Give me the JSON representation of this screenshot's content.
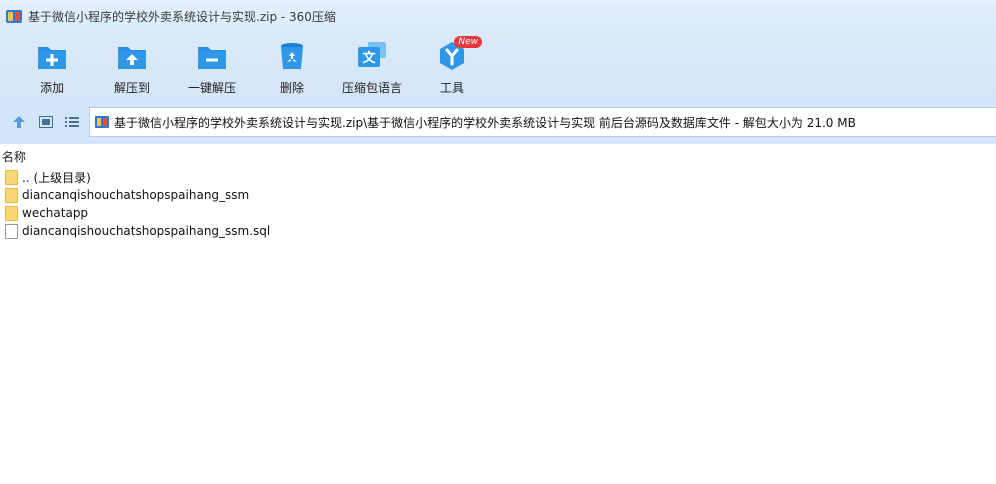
{
  "window": {
    "title": "基于微信小程序的学校外卖系统设计与实现.zip - 360压缩"
  },
  "toolbar": {
    "items": [
      {
        "label": "添加",
        "icon": "add-folder-icon"
      },
      {
        "label": "解压到",
        "icon": "extract-to-icon"
      },
      {
        "label": "一键解压",
        "icon": "one-click-extract-icon"
      },
      {
        "label": "删除",
        "icon": "delete-icon"
      },
      {
        "label": "压缩包语言",
        "icon": "language-icon"
      },
      {
        "label": "工具",
        "icon": "tools-icon",
        "badge": "New"
      }
    ]
  },
  "address": {
    "path": "基于微信小程序的学校外卖系统设计与实现.zip\\基于微信小程序的学校外卖系统设计与实现 前后台源码及数据库文件 - 解包大小为 21.0 MB"
  },
  "list": {
    "column_name": "名称",
    "rows": [
      {
        "name": ".. (上级目录)",
        "type": "folder"
      },
      {
        "name": "diancanqishouchatshopspaihang_ssm",
        "type": "folder"
      },
      {
        "name": "wechatapp",
        "type": "folder"
      },
      {
        "name": "diancanqishouchatshopspaihang_ssm.sql",
        "type": "file"
      }
    ]
  },
  "colors": {
    "accent": "#2b8de0",
    "titlebar": "#e4f0fb",
    "toolbar": "#d3e5f8",
    "badge": "#e8363d"
  }
}
